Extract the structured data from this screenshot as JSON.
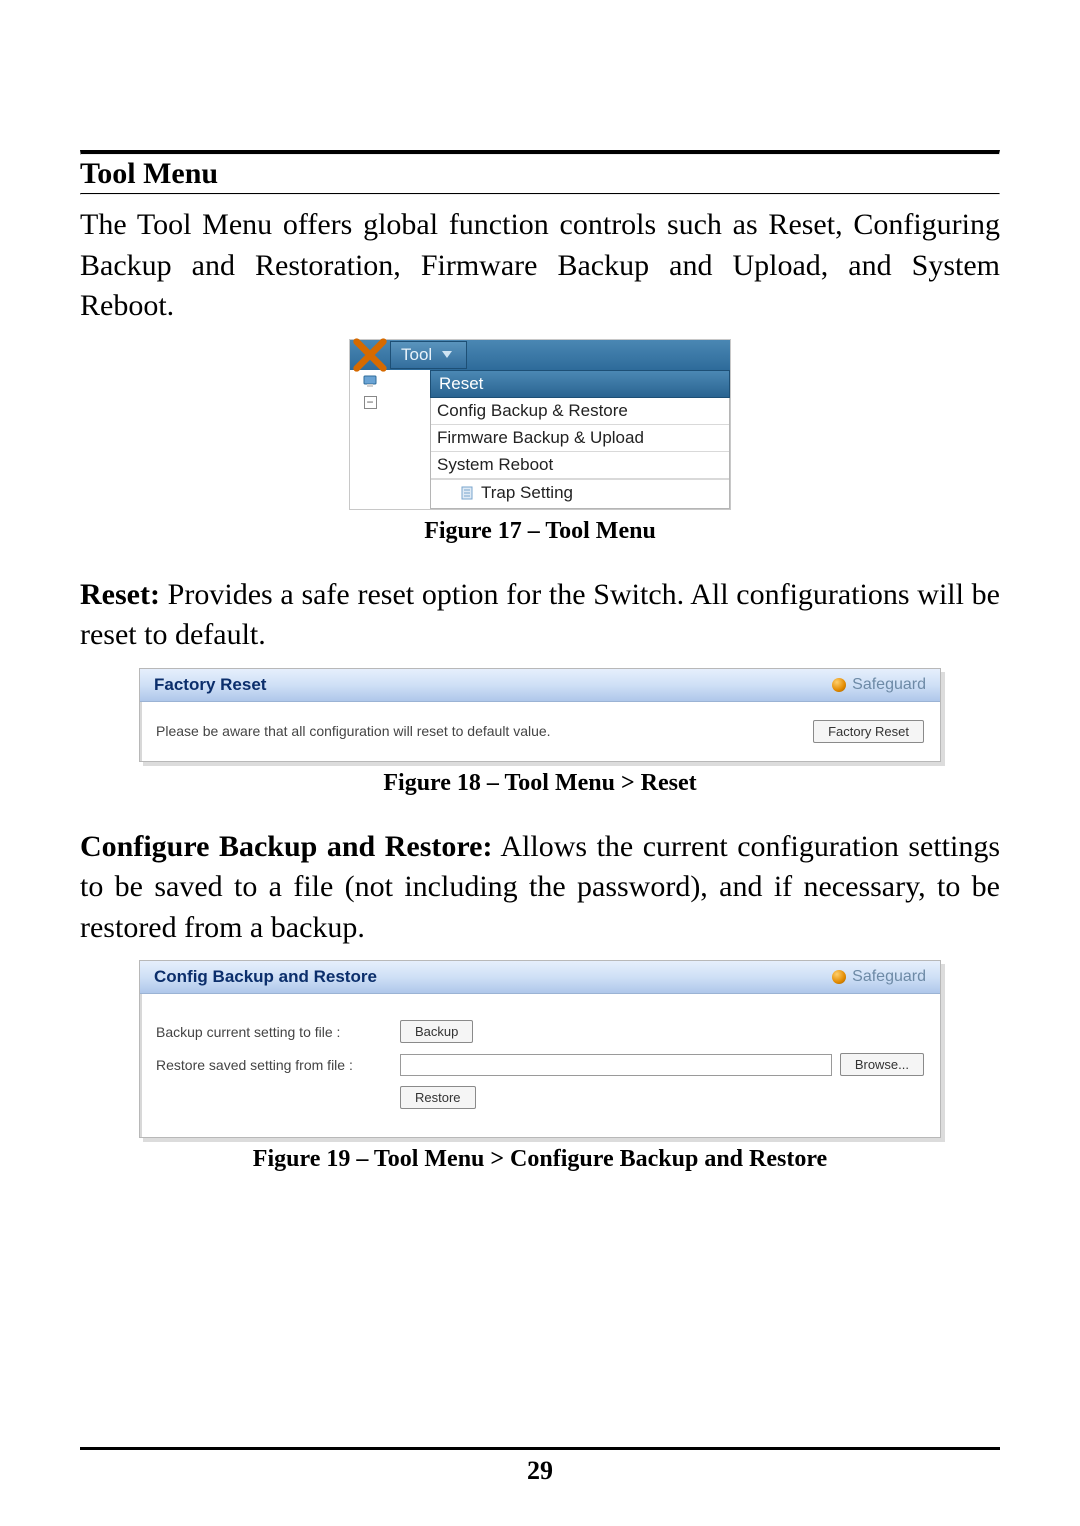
{
  "heading": "Tool Menu",
  "intro": "The Tool Menu offers global function controls such as Reset, Configuring Backup and Restoration, Firmware Backup and Upload, and System Reboot.",
  "fig17": {
    "tool_label": "Tool",
    "reset": "Reset",
    "items": [
      "Config Backup & Restore",
      "Firmware Backup & Upload",
      "System Reboot"
    ],
    "trap": "Trap Setting",
    "caption": "Figure 17 – Tool Menu"
  },
  "reset_section": {
    "bold": "Reset:",
    "text": " Provides a safe reset option for the Switch. All configurations will be reset to default."
  },
  "fig18": {
    "title": "Factory Reset",
    "safeguard": "Safeguard",
    "msg": "Please be aware that all configuration will reset to default value.",
    "button": "Factory Reset",
    "caption": "Figure 18 – Tool Menu > Reset"
  },
  "cbr_section": {
    "bold": "Configure Backup and Restore:",
    "text": " Allows the current configuration settings to be saved to a file (not including the password), and if necessary, to be restored from a backup."
  },
  "fig19": {
    "title": "Config Backup and Restore",
    "safeguard": "Safeguard",
    "row1_label": "Backup current setting to file :",
    "row1_button": "Backup",
    "row2_label": "Restore saved setting from file :",
    "row2_browse": "Browse...",
    "row2_button": "Restore",
    "caption": "Figure 19 – Tool Menu > Configure Backup and Restore"
  },
  "page_number": "29"
}
